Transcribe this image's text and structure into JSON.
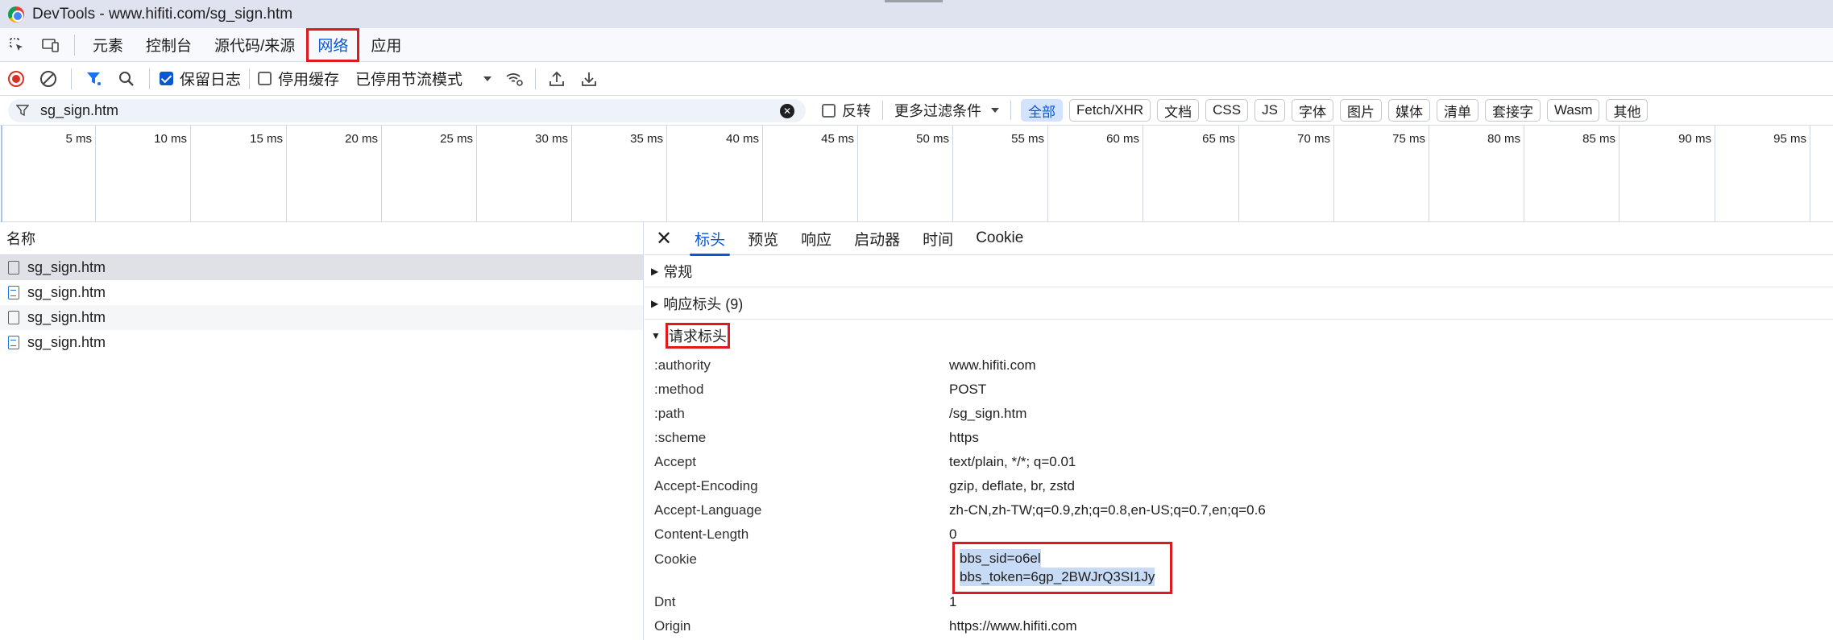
{
  "window": {
    "title": "DevTools - www.hifiti.com/sg_sign.htm"
  },
  "panel_tabs": [
    "元素",
    "控制台",
    "源代码/来源",
    "网络",
    "应用"
  ],
  "active_panel": "网络",
  "toolbar": {
    "preserve_log_label": "保留日志",
    "preserve_log_checked": true,
    "disable_cache_label": "停用缓存",
    "disable_cache_checked": false,
    "throttle_value": "已停用节流模式"
  },
  "filter": {
    "value": "sg_sign.htm",
    "invert_label": "反转",
    "more_filters_label": "更多过滤条件",
    "chips": [
      "全部",
      "Fetch/XHR",
      "文档",
      "CSS",
      "JS",
      "字体",
      "图片",
      "媒体",
      "清单",
      "套接字",
      "Wasm",
      "其他"
    ],
    "active_chip": "全部"
  },
  "timeline": {
    "ticks": [
      "5 ms",
      "10 ms",
      "15 ms",
      "20 ms",
      "25 ms",
      "30 ms",
      "35 ms",
      "40 ms",
      "45 ms",
      "50 ms",
      "55 ms",
      "60 ms",
      "65 ms",
      "70 ms",
      "75 ms",
      "80 ms",
      "85 ms",
      "90 ms",
      "95 ms"
    ]
  },
  "request_list": {
    "header": "名称",
    "rows": [
      {
        "name": "sg_sign.htm",
        "icon": "file-icon"
      },
      {
        "name": "sg_sign.htm",
        "icon": "document-icon"
      },
      {
        "name": "sg_sign.htm",
        "icon": "file-icon"
      },
      {
        "name": "sg_sign.htm",
        "icon": "document-icon"
      }
    ]
  },
  "detail": {
    "tabs": [
      "标头",
      "预览",
      "响应",
      "启动器",
      "时间",
      "Cookie"
    ],
    "active_tab": "标头",
    "sections": {
      "general": "常规",
      "response_headers": "响应标头 (9)",
      "request_headers": "请求标头"
    },
    "request_headers": [
      {
        "key": ":authority",
        "value": "www.hifiti.com"
      },
      {
        "key": ":method",
        "value": "POST"
      },
      {
        "key": ":path",
        "value": "/sg_sign.htm"
      },
      {
        "key": ":scheme",
        "value": "https"
      },
      {
        "key": "Accept",
        "value": "text/plain, */*; q=0.01"
      },
      {
        "key": "Accept-Encoding",
        "value": "gzip, deflate, br, zstd"
      },
      {
        "key": "Accept-Language",
        "value": "zh-CN,zh-TW;q=0.9,zh;q=0.8,en-US;q=0.7,en;q=0.6"
      },
      {
        "key": "Content-Length",
        "value": "0"
      },
      {
        "key": "Cookie",
        "value": ""
      },
      {
        "key": "Dnt",
        "value": "1"
      },
      {
        "key": "Origin",
        "value": "https://www.hifiti.com"
      }
    ],
    "cookie_lines": [
      "bbs_sid=o6el",
      "bbs_token=6gp_2BWJrQ3SI1Jy"
    ]
  },
  "colors": {
    "accent": "#0b57d0",
    "highlight_box": "#e0191f",
    "record_stop": "#d93025"
  }
}
